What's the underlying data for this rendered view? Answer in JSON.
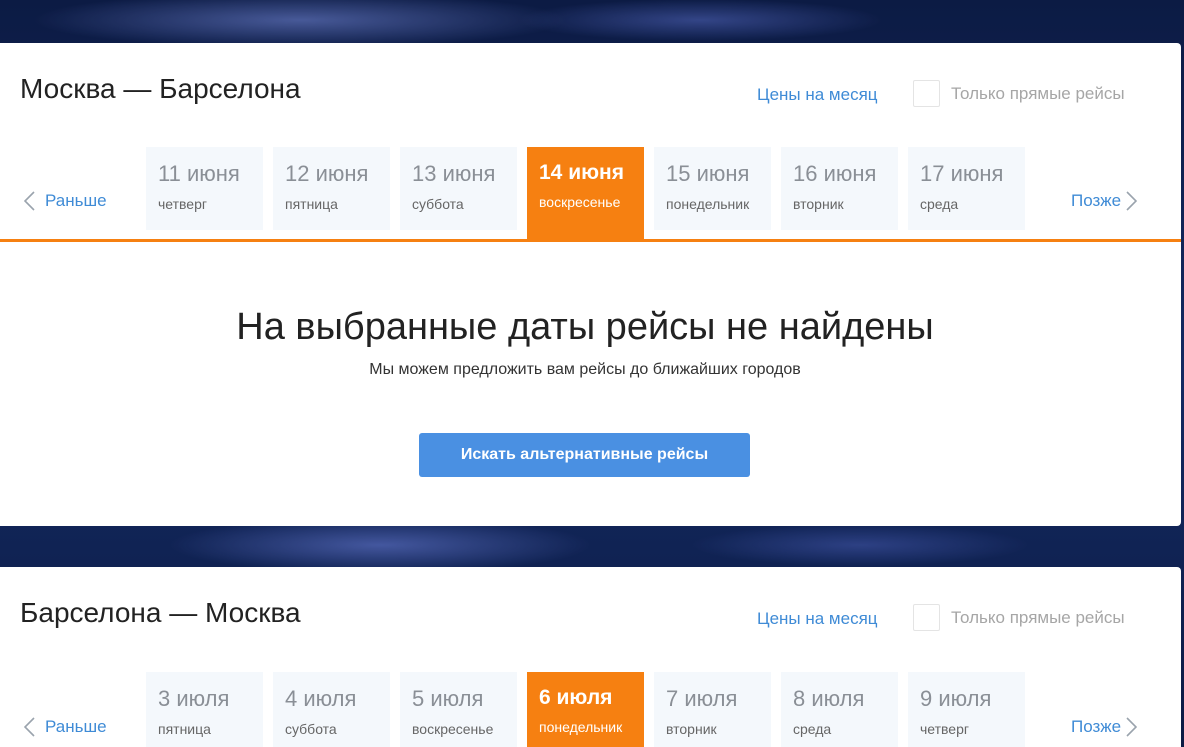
{
  "routes": [
    {
      "title": "Москва — Барселона",
      "month_prices": "Цены на месяц",
      "direct_only": "Только прямые рейсы",
      "prev": "Раньше",
      "next": "Позже",
      "dates": [
        {
          "day": "11 июня",
          "weekday": "четверг"
        },
        {
          "day": "12 июня",
          "weekday": "пятница"
        },
        {
          "day": "13 июня",
          "weekday": "суббота"
        },
        {
          "day": "14 июня",
          "weekday": "воскресенье",
          "selected": true
        },
        {
          "day": "15 июня",
          "weekday": "понедельник"
        },
        {
          "day": "16 июня",
          "weekday": "вторник"
        },
        {
          "day": "17 июня",
          "weekday": "среда"
        }
      ],
      "empty": {
        "title": "На выбранные даты рейсы не найдены",
        "subtitle": "Мы можем предложить вам рейсы до ближайших городов",
        "button": "Искать альтернативные рейсы"
      }
    },
    {
      "title": "Барселона — Москва",
      "month_prices": "Цены на месяц",
      "direct_only": "Только прямые рейсы",
      "prev": "Раньше",
      "next": "Позже",
      "dates": [
        {
          "day": "3 июля",
          "weekday": "пятница"
        },
        {
          "day": "4 июля",
          "weekday": "суббота"
        },
        {
          "day": "5 июля",
          "weekday": "воскресенье"
        },
        {
          "day": "6 июля",
          "weekday": "понедельник",
          "selected": true
        },
        {
          "day": "7 июля",
          "weekday": "вторник"
        },
        {
          "day": "8 июля",
          "weekday": "среда"
        },
        {
          "day": "9 июля",
          "weekday": "четверг"
        }
      ]
    }
  ],
  "colors": {
    "accent": "#f68011",
    "link": "#3f8bd6",
    "button": "#4a90e2"
  }
}
